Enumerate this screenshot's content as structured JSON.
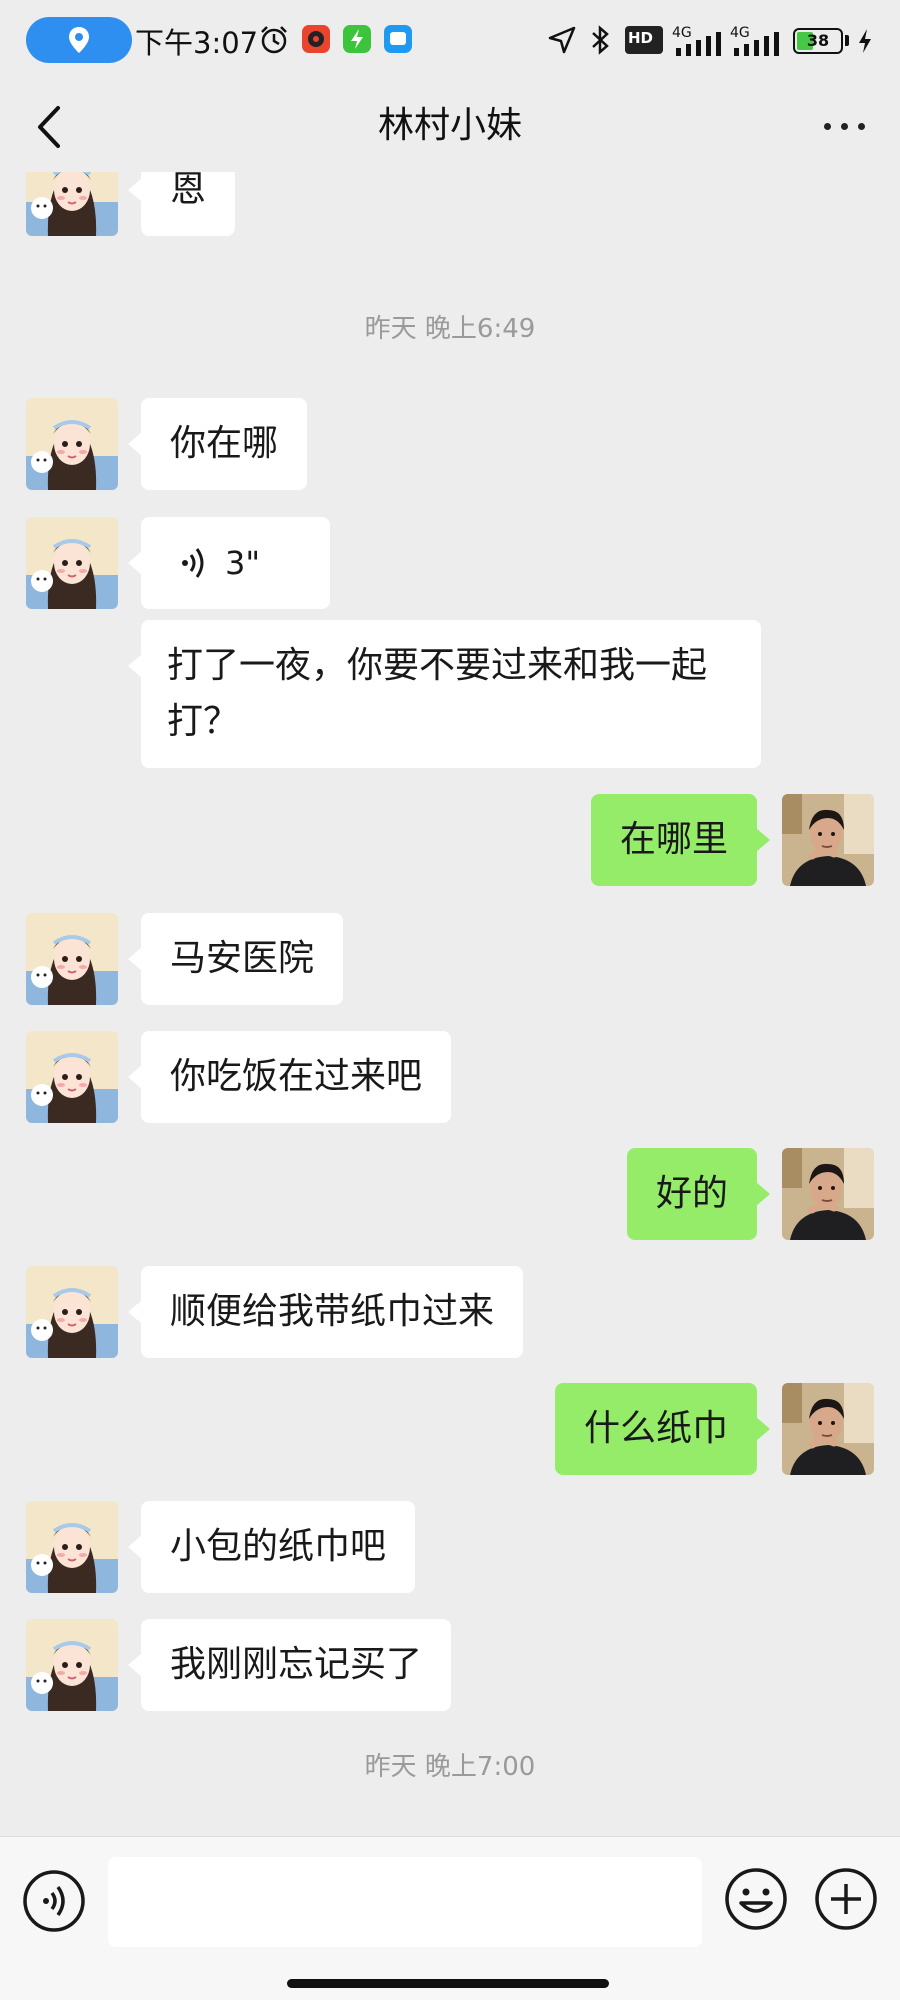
{
  "status_bar": {
    "time": "下午3:07",
    "network_1": "4G",
    "network_2": "4G",
    "hd_label": "HD",
    "battery": "38",
    "battery_level": 0.38,
    "battery_color": "#46c746",
    "location_pill_color": "#2f8ff0"
  },
  "header": {
    "title": "林村小妹",
    "back_icon": "chevron-left-icon",
    "more_icon": "more-dots-icon"
  },
  "messages": [
    {
      "side": "in",
      "text": "恩"
    },
    {
      "timestamp": "昨天 晚上6:49"
    },
    {
      "side": "in",
      "text": "你在哪"
    },
    {
      "side": "in",
      "type": "voice",
      "duration": "3\""
    },
    {
      "side": "in",
      "text": "打了一夜，你要不要过来和我一起打？"
    },
    {
      "side": "out",
      "text": "在哪里"
    },
    {
      "side": "in",
      "text": "马安医院"
    },
    {
      "side": "in",
      "text": "你吃饭在过来吧"
    },
    {
      "side": "out",
      "text": "好的"
    },
    {
      "side": "in",
      "text": "顺便给我带纸巾过来"
    },
    {
      "side": "out",
      "text": "什么纸巾"
    },
    {
      "side": "in",
      "text": "小包的纸巾吧"
    },
    {
      "side": "in",
      "text": "我刚刚忘记买了"
    },
    {
      "timestamp": "昨天 晚上7:00"
    }
  ],
  "input_bar": {
    "placeholder": "",
    "voice_icon": "voice-input-icon",
    "emoji_icon": "emoji-icon",
    "plus_icon": "plus-icon"
  },
  "colors": {
    "background": "#ededed",
    "incoming_bubble": "#ffffff",
    "outgoing_bubble": "#95ec69",
    "timestamp_text": "#9a9a9a"
  }
}
